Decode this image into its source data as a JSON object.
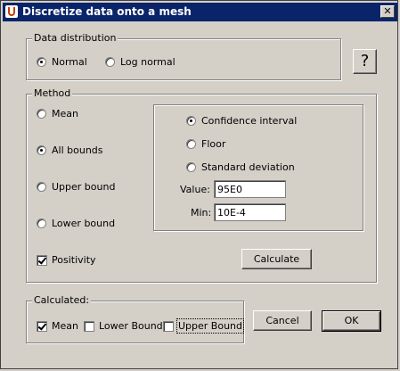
{
  "window": {
    "title": "Discretize data onto a mesh",
    "close_glyph": "✕"
  },
  "distribution": {
    "legend": "Data distribution",
    "options": [
      {
        "label": "Normal",
        "selected": true
      },
      {
        "label": "Log normal",
        "selected": false
      }
    ],
    "help_label": "?"
  },
  "method": {
    "legend": "Method",
    "options": [
      {
        "label": "Mean",
        "selected": false
      },
      {
        "label": "All bounds",
        "selected": true
      },
      {
        "label": "Upper bound",
        "selected": false
      },
      {
        "label": "Lower bound",
        "selected": false
      }
    ],
    "positivity_label": "Positivity",
    "positivity_checked": true,
    "bound_options": [
      {
        "label": "Confidence interval",
        "selected": true
      },
      {
        "label": "Floor",
        "selected": false
      },
      {
        "label": "Standard deviation",
        "selected": false
      }
    ],
    "value_label": "Value:",
    "value": "95E0",
    "min_label": "Min:",
    "min": "10E-4",
    "calculate_label": "Calculate"
  },
  "calculated": {
    "legend": "Calculated:",
    "items": [
      {
        "label": "Mean",
        "checked": true
      },
      {
        "label": "Lower Bound",
        "checked": false
      },
      {
        "label": "Upper Bound",
        "checked": false
      }
    ]
  },
  "buttons": {
    "cancel": "Cancel",
    "ok": "OK"
  }
}
